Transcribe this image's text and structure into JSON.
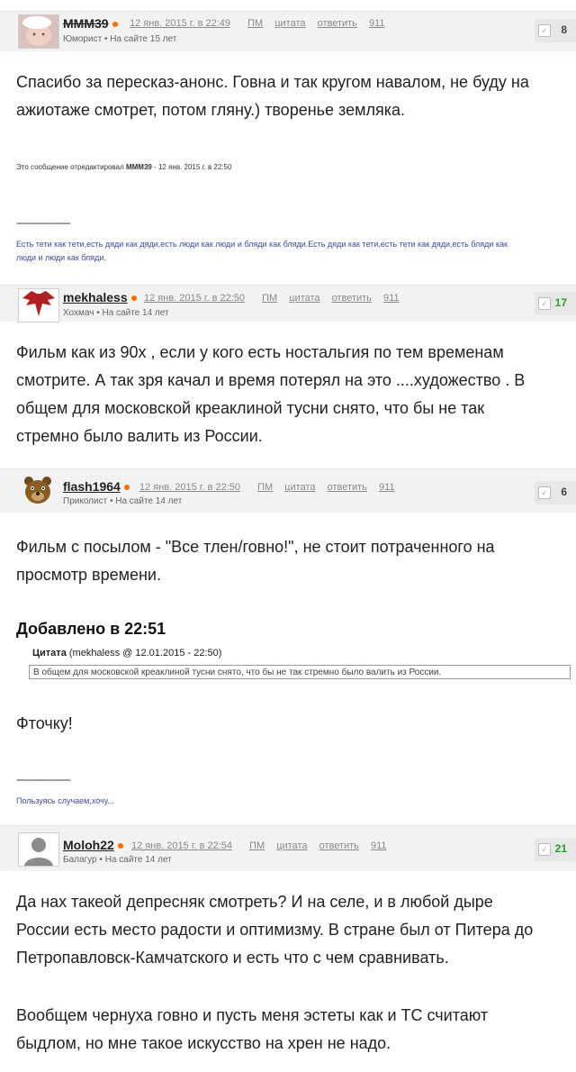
{
  "posts": [
    {
      "username": "MMM39",
      "date": "12 янв. 2015 г. в 22:49",
      "pm": "ПМ",
      "quote": "цитата",
      "reply": "ответить",
      "num": "911",
      "rank": "Юморист",
      "on_site": "На сайте 15 лет",
      "score": "8",
      "text": [
        "Спасибо за пересказ-анонс. Говна и так кругом навалом, не буду на",
        "ажиотаже смотрет, потом гляну.) творенье земляка."
      ],
      "edited_prefix": "Это сообщение отредактировал ",
      "edited_user": "MMM39",
      "edited_suffix": " - 12 янв. 2015 г. в 22:50",
      "sig_dashes": "--------------------",
      "signature": [
        "Есть тети как тети,есть дяди как дяди,есть люди как люди и бляди как бляди.Есть дяди как тети,есть тети как дяди,есть бляди как",
        "люди и люди как бляди."
      ]
    },
    {
      "username": "mekhaless",
      "date": "12 янв. 2015 г. в 22:50",
      "pm": "ПМ",
      "quote": "цитата",
      "reply": "ответить",
      "num": "911",
      "rank": "Хохмач",
      "on_site": "На сайте 14 лет",
      "score": "17",
      "text": [
        "Фильм как из 90х , если у кого есть ностальгия по тем временам",
        "смотрите. А так зря качал и время потерял на это ....художество . В",
        "общем для московской креаклиной тусни снято, что бы не так",
        "стремно было валить из России."
      ]
    },
    {
      "username": "flash1964",
      "date": "12 янв. 2015 г. в 22:50",
      "pm": "ПМ",
      "quote": "цитата",
      "reply": "ответить",
      "num": "911",
      "rank": "Приколист",
      "on_site": "На сайте 14 лет",
      "score": "6",
      "text": [
        "Фильм с посылом - \"Все тлен/говно!\", не стоит потраченного на",
        "просмотр времени."
      ],
      "added": "Добавлено в 22:51",
      "quote_label": "Цитата",
      "quote_src": " (mekhaless @ 12.01.2015 - 22:50)",
      "quote_text": "В общем для московской креаклиной тусни снято, что бы не так стремно было валить из России.",
      "after": "Фточку!",
      "sig_dashes": "--------------------",
      "signature": "Пользуясь случаем,хочу..."
    },
    {
      "username": "Moloh22",
      "date": "12 янв. 2015 г. в 22:54",
      "pm": "ПМ",
      "quote": "цитата",
      "reply": "ответить",
      "num": "911",
      "rank": "Балагур",
      "on_site": "На сайте 14 лет",
      "score": "21",
      "text": [
        "Да нах такеой депресняк смотреть? И на селе, и в любой дыре",
        "России есть место радости и оптимизму. В стране был от Питера до",
        "Петропавловск-Камчатского и есть что с чем сравнивать."
      ],
      "text2": [
        "Вообщем чернуха говно и пусть меня эстеты как и ТС считают",
        "быдлом, но мне такое искусство на хрен не надо."
      ]
    }
  ],
  "separator": "•",
  "colors": {
    "accent": "#ff6a00",
    "positive": "#2a9d2a",
    "signature": "#3b4ba0"
  }
}
